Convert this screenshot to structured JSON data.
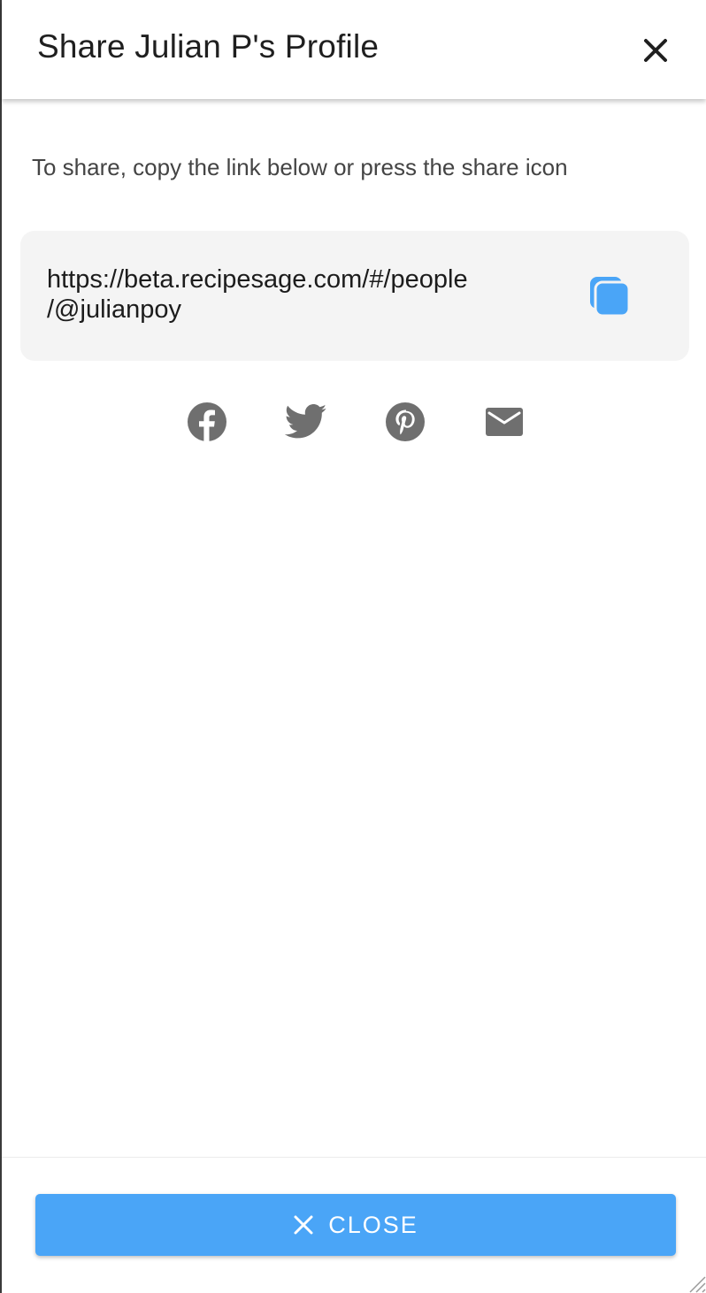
{
  "modal": {
    "title": "Share Julian P's Profile",
    "close_icon": "close-icon"
  },
  "share": {
    "instructions": "To share, copy the link below or press the share icon",
    "link_line_1": "https://beta.recipesage.com/#/people",
    "link_line_2": "/@julianpoy",
    "copy_icon": "copy-icon"
  },
  "social": [
    {
      "name": "facebook-icon"
    },
    {
      "name": "twitter-icon"
    },
    {
      "name": "pinterest-icon"
    },
    {
      "name": "email-icon"
    }
  ],
  "footer": {
    "close_label": "CLOSE",
    "close_icon": "close-icon"
  },
  "colors": {
    "accent": "#4aa5f7",
    "icon_gray": "#6f6f6f",
    "link_box_bg": "#f4f4f4"
  }
}
